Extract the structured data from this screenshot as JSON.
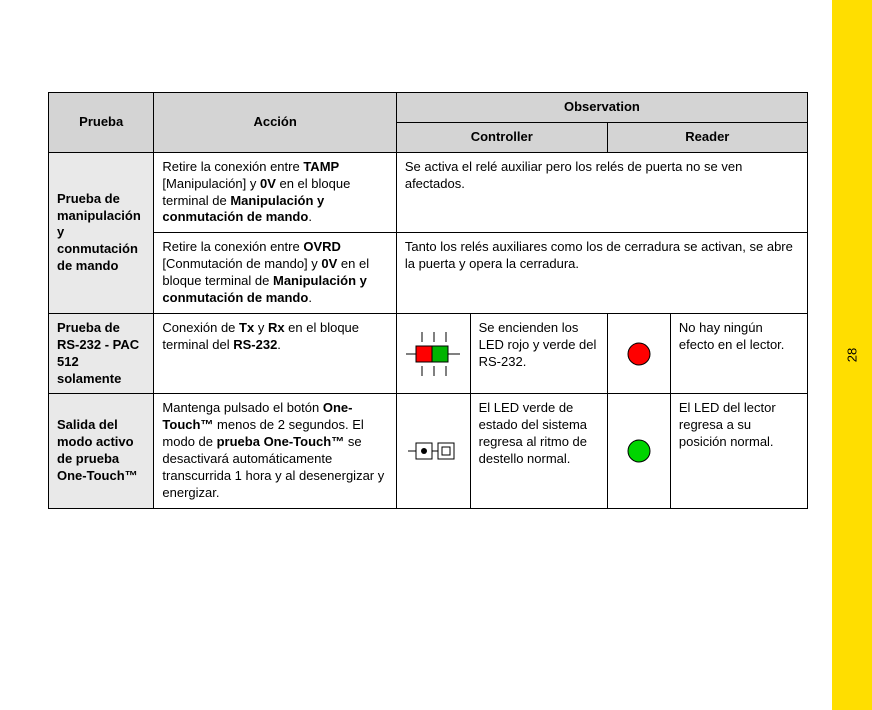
{
  "page_number": "28",
  "headers": {
    "prueba": "Prueba",
    "accion": "Acción",
    "observation": "Observation",
    "controller": "Controller",
    "reader": "Reader"
  },
  "rows": {
    "r1": {
      "prueba": "Prueba de manipulación y conmutación de mando",
      "accion_a_pre": "Retire la conexión entre ",
      "accion_a_b1": "TAMP",
      "accion_a_mid1": " [Manipulación] y ",
      "accion_a_b2": "0V",
      "accion_a_mid2": " en el bloque terminal de ",
      "accion_a_b3": "Manipulación y conmutación de mando",
      "accion_a_post": ".",
      "obs_a": "Se activa el relé auxiliar pero los relés de puerta no se ven afectados.",
      "accion_b_pre": "Retire la conexión entre ",
      "accion_b_b1": "OVRD",
      "accion_b_mid1": " [Conmutación de mando] y ",
      "accion_b_b2": "0V",
      "accion_b_mid2": " en el bloque terminal de ",
      "accion_b_b3": "Manipulación y conmutación de mando",
      "accion_b_post": ".",
      "obs_b": "Tanto los relés auxiliares como los de cerradura se activan, se abre la puerta y opera la cerradura."
    },
    "r2": {
      "prueba": "Prueba de RS-232 - PAC 512 solamente",
      "accion_pre": "Conexión de ",
      "accion_b1": "Tx",
      "accion_mid1": " y ",
      "accion_b2": "Rx",
      "accion_mid2": " en el bloque terminal del ",
      "accion_b3": "RS-232",
      "accion_post": ".",
      "controller": "Se encienden los LED rojo y verde del RS-232.",
      "reader": "No hay ningún efecto en el lector."
    },
    "r3": {
      "prueba": "Salida del modo activo de prueba One-Touch™",
      "accion_pre": "Mantenga pulsado el botón ",
      "accion_b1": "One-Touch™",
      "accion_mid1": " menos de 2 segundos. El modo de ",
      "accion_b2": "prueba One-Touch™",
      "accion_post": " se desactivará automáticamente transcurrida 1 hora y al desenergizar y energizar.",
      "controller": "El LED verde de estado del sistema regresa al ritmo de destello normal.",
      "reader": "El LED del lector regresa a su posición normal."
    }
  },
  "icons": {
    "led_red_green": "led-red-green-terminal-icon",
    "led_red": "led-red-icon",
    "led_button_terminal": "led-button-terminal-icon",
    "led_green": "led-green-icon"
  }
}
